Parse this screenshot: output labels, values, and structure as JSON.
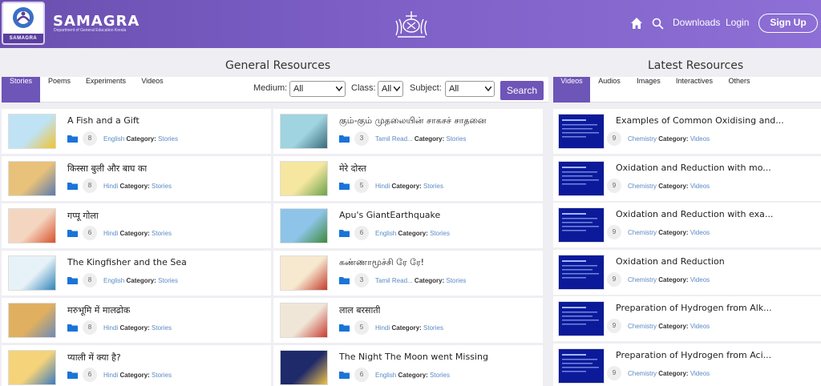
{
  "header": {
    "logo_band": "SAMAGRA",
    "brand_title": "SAMAGRA",
    "brand_subtitle": "Department of General Education Kerala",
    "nav": {
      "downloads": "Downloads",
      "login": "Login",
      "signup": "Sign Up"
    },
    "colors": {
      "header_start": "#6a4fb0",
      "header_end": "#8d6fd6",
      "accent": "#6e55b8"
    }
  },
  "general": {
    "title": "General Resources",
    "tabs": [
      "Stories",
      "Poems",
      "Experiments",
      "Videos"
    ],
    "active_tab": "Stories",
    "filters": {
      "medium_label": "Medium:",
      "medium_value": "All",
      "class_label": "Class:",
      "class_value": "All",
      "subject_label": "Subject:",
      "subject_value": "All",
      "search_label": "Search"
    },
    "cards": [
      {
        "title": "A Fish and a Gift",
        "count": "8",
        "lang": "English",
        "cat_label": "Category:",
        "cat": "Stories"
      },
      {
        "title": "கும்-கும் முதலையின் சாகசச் சாதனை",
        "count": "3",
        "lang": "Tamil Read...",
        "cat_label": "Category:",
        "cat": "Stories"
      },
      {
        "title": "किस्सा बुली और बाघ का",
        "count": "8",
        "lang": "Hindi",
        "cat_label": "Category:",
        "cat": "Stories"
      },
      {
        "title": "मेरे दोस्त",
        "count": "5",
        "lang": "Hindi",
        "cat_label": "Category:",
        "cat": "Stories"
      },
      {
        "title": "गप्पू गोला",
        "count": "6",
        "lang": "Hindi",
        "cat_label": "Category:",
        "cat": "Stories"
      },
      {
        "title": "Apu's GiantEarthquake",
        "count": "6",
        "lang": "English",
        "cat_label": "Category:",
        "cat": "Stories"
      },
      {
        "title": "The Kingfisher and the Sea",
        "count": "8",
        "lang": "English",
        "cat_label": "Category:",
        "cat": "Stories"
      },
      {
        "title": "கண்ணாமூச்சி ரே ரே!",
        "count": "3",
        "lang": "Tamil Read...",
        "cat_label": "Category:",
        "cat": "Stories"
      },
      {
        "title": "मरुभूमि में मालढोक",
        "count": "8",
        "lang": "Hindi",
        "cat_label": "Category:",
        "cat": "Stories"
      },
      {
        "title": "लाल बरसाती",
        "count": "5",
        "lang": "Hindi",
        "cat_label": "Category:",
        "cat": "Stories"
      },
      {
        "title": "प्याली में क्या है?",
        "count": "6",
        "lang": "Hindi",
        "cat_label": "Category:",
        "cat": "Stories"
      },
      {
        "title": "The Night The Moon went Missing",
        "count": "6",
        "lang": "English",
        "cat_label": "Category:",
        "cat": "Stories"
      }
    ]
  },
  "latest": {
    "title": "Latest Resources",
    "tabs": [
      "Videos",
      "Audios",
      "Images",
      "Interactives",
      "Others"
    ],
    "active_tab": "Videos",
    "cards": [
      {
        "title": "Examples of Common Oxidising and...",
        "count": "9",
        "subject": "Chemistry",
        "cat_label": "Category:",
        "cat": "Videos"
      },
      {
        "title": "Oxidation and Reduction with mo...",
        "count": "9",
        "subject": "Chemistry",
        "cat_label": "Category:",
        "cat": "Videos"
      },
      {
        "title": "Oxidation and Reduction with exa...",
        "count": "9",
        "subject": "Chemistry",
        "cat_label": "Category:",
        "cat": "Videos"
      },
      {
        "title": "Oxidation and Reduction",
        "count": "9",
        "subject": "Chemistry",
        "cat_label": "Category:",
        "cat": "Videos"
      },
      {
        "title": "Preparation of Hydrogen from Alk...",
        "count": "9",
        "subject": "Chemistry",
        "cat_label": "Category:",
        "cat": "Videos"
      },
      {
        "title": "Preparation of Hydrogen from Aci...",
        "count": "9",
        "subject": "Chemistry",
        "cat_label": "Category:",
        "cat": "Videos"
      }
    ]
  }
}
